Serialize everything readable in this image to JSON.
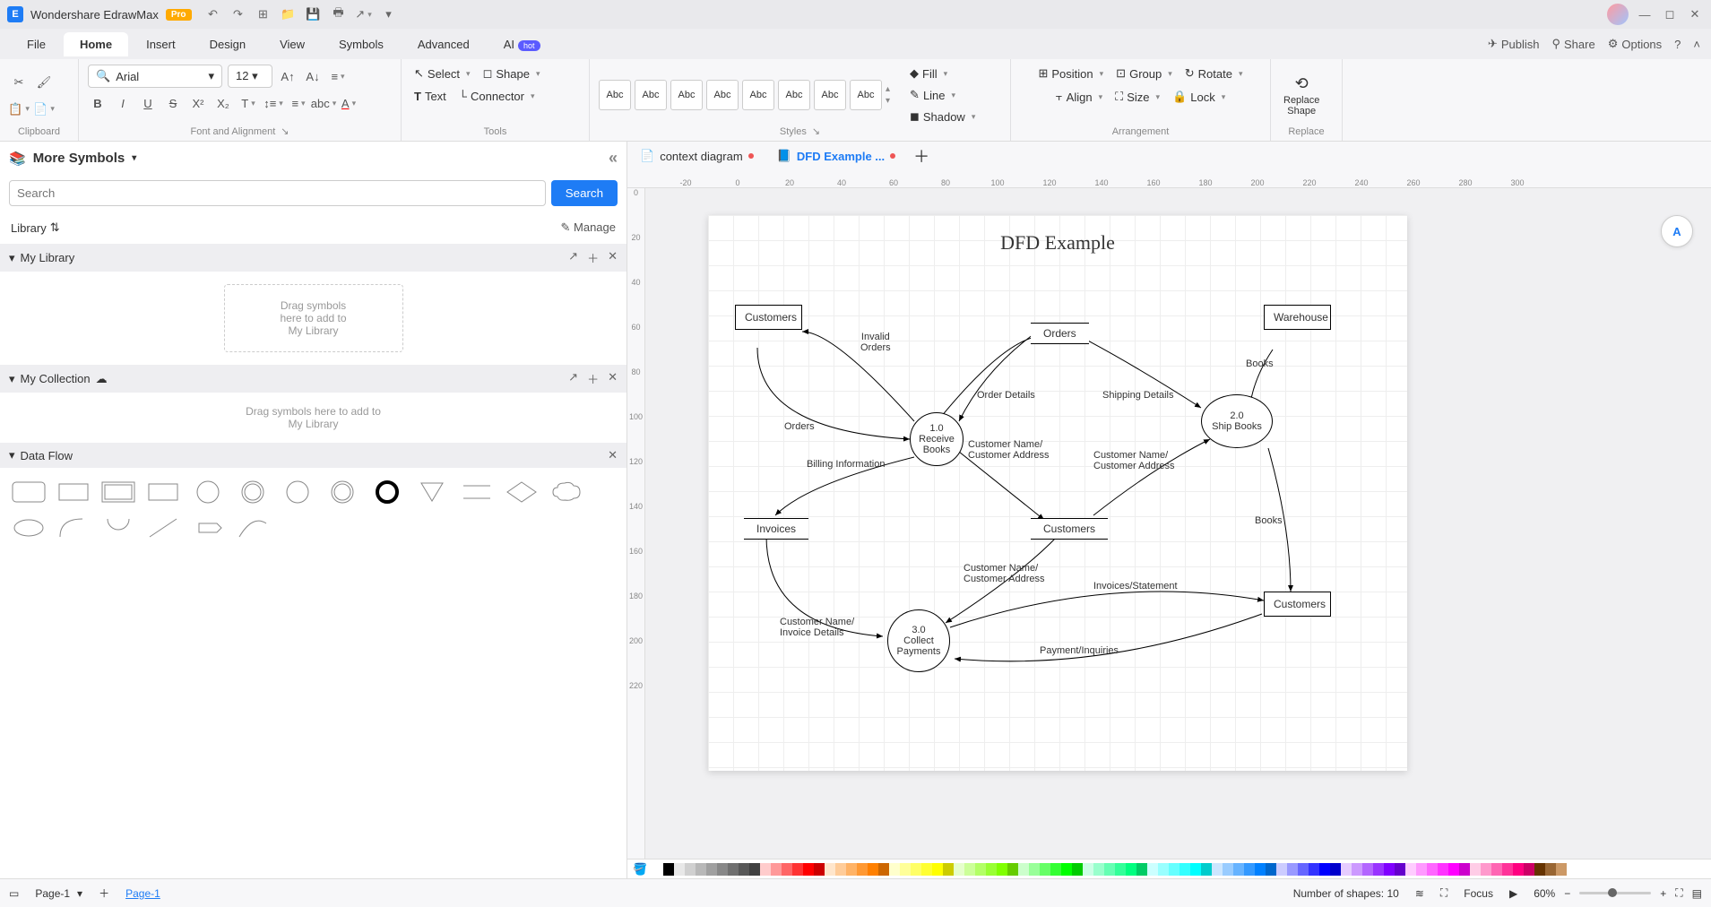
{
  "app": {
    "name": "Wondershare EdrawMax",
    "badge": "Pro"
  },
  "menu": {
    "tabs": [
      "File",
      "Home",
      "Insert",
      "Design",
      "View",
      "Symbols",
      "Advanced",
      "AI"
    ],
    "active": "Home",
    "hot_badge": "hot",
    "right": {
      "publish": "Publish",
      "share": "Share",
      "options": "Options"
    }
  },
  "ribbon": {
    "clipboard": {
      "label": "Clipboard"
    },
    "font": {
      "family": "Arial",
      "size": "12",
      "label": "Font and Alignment"
    },
    "tools": {
      "select": "Select",
      "shape": "Shape",
      "text": "Text",
      "connector": "Connector",
      "label": "Tools"
    },
    "styles": {
      "sample": "Abc",
      "label": "Styles",
      "fill": "Fill",
      "line": "Line",
      "shadow": "Shadow"
    },
    "arrangement": {
      "position": "Position",
      "align": "Align",
      "group": "Group",
      "size": "Size",
      "rotate": "Rotate",
      "lock": "Lock",
      "label": "Arrangement"
    },
    "replace": {
      "title": "Replace\nShape",
      "label": "Replace"
    }
  },
  "symbols": {
    "title": "More Symbols",
    "search_placeholder": "Search",
    "search_btn": "Search",
    "library": "Library",
    "manage": "Manage",
    "my_library": "My Library",
    "drop1": "Drag symbols\nhere to add to\nMy Library",
    "my_collection": "My Collection",
    "drop2": "Drag symbols here to add to\nMy Library",
    "data_flow": "Data Flow"
  },
  "docs": {
    "tab1": "context diagram",
    "tab2": "DFD Example ..."
  },
  "ruler_h": [
    "-20",
    "0",
    "20",
    "40",
    "60",
    "80",
    "100",
    "120",
    "140",
    "160",
    "180",
    "200",
    "220",
    "240",
    "260",
    "280",
    "300"
  ],
  "ruler_v": [
    "0",
    "20",
    "40",
    "60",
    "80",
    "100",
    "120",
    "140",
    "160",
    "180",
    "200",
    "220"
  ],
  "dfd": {
    "title": "DFD Example",
    "entities": {
      "customers1": "Customers",
      "warehouse": "Warehouse",
      "customers2": "Customers"
    },
    "processes": {
      "p1_num": "1.0",
      "p1_name": "Receive\nBooks",
      "p2_num": "2.0",
      "p2_name": "Ship Books",
      "p3_num": "3.0",
      "p3_name": "Collect\nPayments"
    },
    "stores": {
      "orders": "Orders",
      "invoices": "Invoices",
      "customers_store": "Customers"
    },
    "flows": {
      "invalid_orders": "Invalid\nOrders",
      "orders": "Orders",
      "order_details": "Order Details",
      "shipping_details": "Shipping Details",
      "books1": "Books",
      "cust_name1": "Customer Name/\nCustomer Address",
      "cust_name2": "Customer Name/\nCustomer Address",
      "billing": "Billing Information",
      "books2": "Books",
      "cust_name3": "Customer Name/\nCustomer Address",
      "inv_stmt": "Invoices/Statement",
      "cust_inv": "Customer Name/\nInvoice Details",
      "pay_inq": "Payment/Inquiries"
    }
  },
  "status": {
    "page_sel": "Page-1",
    "page_link": "Page-1",
    "shapes": "Number of shapes: 10",
    "focus": "Focus",
    "zoom": "60%"
  },
  "colors": [
    "#ffffff",
    "#000000",
    "#e8e8e8",
    "#d0d0d0",
    "#b8b8b8",
    "#a0a0a0",
    "#888888",
    "#707070",
    "#585858",
    "#404040",
    "#ffcccc",
    "#ff9999",
    "#ff6666",
    "#ff3333",
    "#ff0000",
    "#cc0000",
    "#ffe6cc",
    "#ffcc99",
    "#ffb366",
    "#ff9933",
    "#ff8000",
    "#cc6600",
    "#ffffcc",
    "#ffff99",
    "#ffff66",
    "#ffff33",
    "#ffff00",
    "#cccc00",
    "#e6ffcc",
    "#ccff99",
    "#b3ff66",
    "#99ff33",
    "#80ff00",
    "#66cc00",
    "#ccffcc",
    "#99ff99",
    "#66ff66",
    "#33ff33",
    "#00ff00",
    "#00cc00",
    "#ccffe6",
    "#99ffcc",
    "#66ffb3",
    "#33ff99",
    "#00ff80",
    "#00cc66",
    "#ccffff",
    "#99ffff",
    "#66ffff",
    "#33ffff",
    "#00ffff",
    "#00cccc",
    "#cce6ff",
    "#99ccff",
    "#66b3ff",
    "#3399ff",
    "#0080ff",
    "#0066cc",
    "#ccccff",
    "#9999ff",
    "#6666ff",
    "#3333ff",
    "#0000ff",
    "#0000cc",
    "#e6ccff",
    "#cc99ff",
    "#b366ff",
    "#9933ff",
    "#8000ff",
    "#6600cc",
    "#ffccff",
    "#ff99ff",
    "#ff66ff",
    "#ff33ff",
    "#ff00ff",
    "#cc00cc",
    "#ffcce6",
    "#ff99cc",
    "#ff66b3",
    "#ff3399",
    "#ff0080",
    "#cc0066",
    "#663300",
    "#996633",
    "#cc9966"
  ]
}
